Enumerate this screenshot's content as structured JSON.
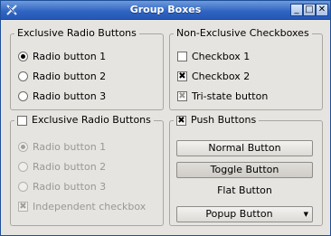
{
  "window": {
    "title": "Group Boxes"
  },
  "titlebar_buttons": {
    "minimize": "_",
    "maximize": "□",
    "close": "✕"
  },
  "group1": {
    "title": "Exclusive Radio Buttons",
    "radios": [
      "Radio button 1",
      "Radio button 2",
      "Radio button 3"
    ],
    "selected_index": 0
  },
  "group2": {
    "title": "Non-Exclusive Checkboxes",
    "checkboxes": [
      {
        "label": "Checkbox 1",
        "state": "unchecked"
      },
      {
        "label": "Checkbox 2",
        "state": "checked"
      },
      {
        "label": "Tri-state button",
        "state": "partial"
      }
    ]
  },
  "group3": {
    "title": "Exclusive Radio Buttons",
    "checked": false,
    "enabled": false,
    "radios": [
      "Radio button 1",
      "Radio button 2",
      "Radio button 3"
    ],
    "selected_index": 0,
    "independent_checkbox": {
      "label": "Independent checkbox",
      "checked": true
    }
  },
  "group4": {
    "title": "Push Buttons",
    "checked": true,
    "buttons": {
      "normal": "Normal Button",
      "toggle": "Toggle Button",
      "flat": "Flat Button",
      "popup": "Popup Button"
    }
  },
  "glyphs": {
    "check": "✖",
    "popup_arrow": "▼"
  },
  "colors": {
    "titlebar": "#2e63c1",
    "background": "#e6e4e0"
  }
}
